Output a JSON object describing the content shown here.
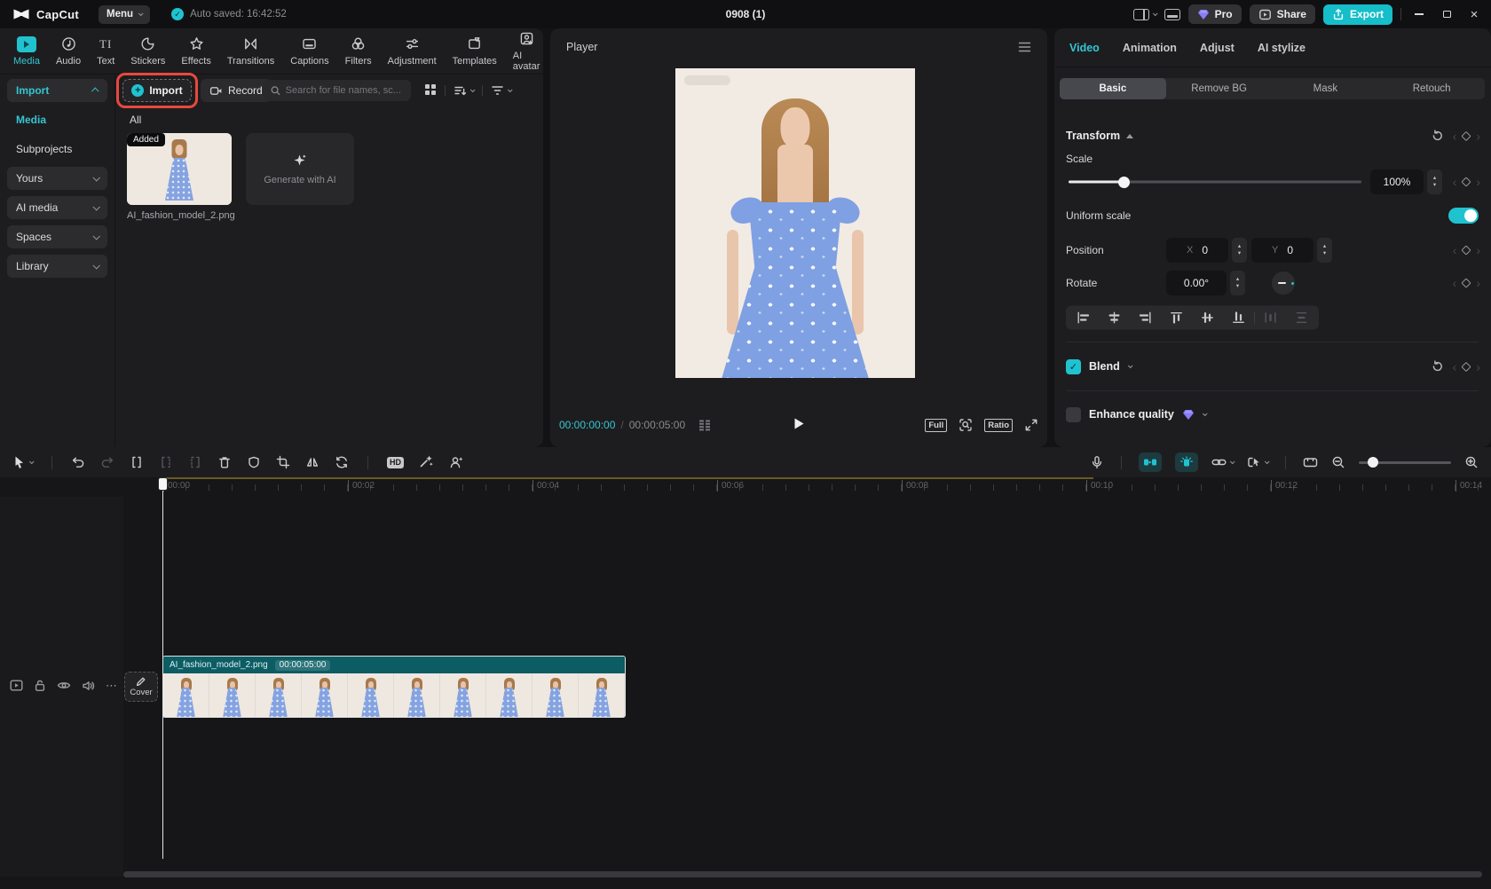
{
  "titlebar": {
    "app_name": "CapCut",
    "menu_label": "Menu",
    "autosave_text": "Auto saved: 16:42:52",
    "project_title": "0908 (1)",
    "pro_label": "Pro",
    "share_label": "Share",
    "export_label": "Export"
  },
  "media_toolbar": {
    "items": [
      {
        "label": "Media",
        "active": true
      },
      {
        "label": "Audio"
      },
      {
        "label": "Text"
      },
      {
        "label": "Stickers"
      },
      {
        "label": "Effects"
      },
      {
        "label": "Transitions"
      },
      {
        "label": "Captions"
      },
      {
        "label": "Filters"
      },
      {
        "label": "Adjustment"
      },
      {
        "label": "Templates"
      },
      {
        "label": "AI avatar"
      }
    ]
  },
  "sidebar": {
    "items": [
      {
        "label": "Import",
        "active": true,
        "expanded": true
      },
      {
        "label": "Media",
        "active": true
      },
      {
        "label": "Subprojects"
      },
      {
        "label": "Yours",
        "collapsed": true
      },
      {
        "label": "AI media",
        "collapsed": true
      },
      {
        "label": "Spaces",
        "collapsed": true
      },
      {
        "label": "Library",
        "collapsed": true
      }
    ]
  },
  "media_panel": {
    "import_label": "Import",
    "record_label": "Record",
    "search_placeholder": "Search for file names, sc...",
    "filter_tab": "All",
    "added_badge": "Added",
    "file_name": "AI_fashion_model_2.png",
    "generate_label": "Generate with AI"
  },
  "player": {
    "title": "Player",
    "current_time": "00:00:00:00",
    "separator": "/",
    "duration": "00:00:05:00",
    "full_label": "Full",
    "ratio_label": "Ratio"
  },
  "inspector": {
    "tabs": [
      "Video",
      "Animation",
      "Adjust",
      "AI stylize"
    ],
    "active_tab": "Video",
    "subtabs": [
      "Basic",
      "Remove BG",
      "Mask",
      "Retouch"
    ],
    "active_subtab": "Basic",
    "transform": {
      "section_label": "Transform",
      "scale_label": "Scale",
      "scale_value": "100%",
      "uniform_scale_label": "Uniform scale",
      "uniform_scale_on": true,
      "position_label": "Position",
      "x_label": "X",
      "x_value": "0",
      "y_label": "Y",
      "y_value": "0",
      "rotate_label": "Rotate",
      "rotate_value": "0.00°"
    },
    "blend": {
      "label": "Blend",
      "checked": true
    },
    "enhance": {
      "label": "Enhance quality",
      "checked": false
    }
  },
  "timeline_toolbar": {
    "hd_label": "HD"
  },
  "timeline": {
    "ruler_labels": [
      "00:00",
      "00:02",
      "00:04",
      "00:06",
      "00:08",
      "00:10",
      "00:12",
      "00:14"
    ],
    "cover_label": "Cover",
    "clip": {
      "name": "AI_fashion_model_2.png",
      "duration": "00:00:05:00"
    }
  },
  "colors": {
    "accent_teal": "#1fc3cf",
    "highlight_red": "#e8493c",
    "clip_header_teal": "#0c5c64",
    "pro_gem_purple": "#8b7cf8",
    "panel_background": "#1d1d20",
    "preview_background": "#f1ebe3"
  }
}
